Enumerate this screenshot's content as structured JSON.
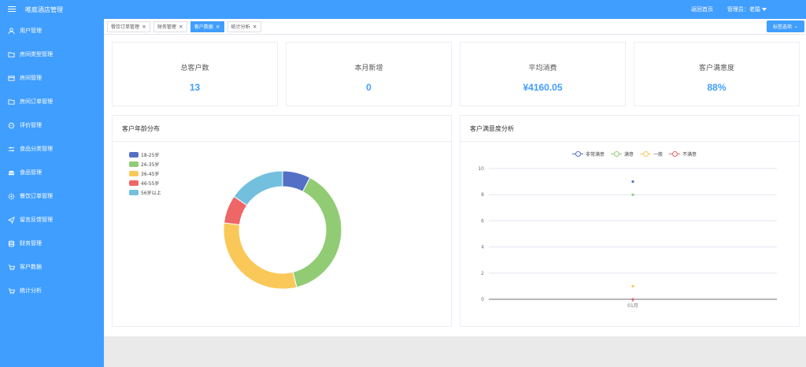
{
  "app": {
    "title": "唯庭酒店管理"
  },
  "sidebar": {
    "items": [
      {
        "label": "用户管理",
        "icon": "user-icon"
      },
      {
        "label": "房间类型管理",
        "icon": "folder-icon"
      },
      {
        "label": "房间管理",
        "icon": "card-icon"
      },
      {
        "label": "房间订单管理",
        "icon": "folder-icon"
      },
      {
        "label": "评价管理",
        "icon": "chat-icon"
      },
      {
        "label": "食品分类管理",
        "icon": "sliders-icon"
      },
      {
        "label": "食品管理",
        "icon": "food-icon"
      },
      {
        "label": "餐饮订单管理",
        "icon": "gear-icon"
      },
      {
        "label": "留言反馈管理",
        "icon": "send-icon"
      },
      {
        "label": "财务管理",
        "icon": "database-icon"
      },
      {
        "label": "客户数据",
        "icon": "cart-icon"
      },
      {
        "label": "统计分析",
        "icon": "cart-icon"
      }
    ]
  },
  "topbar": {
    "home_link": "返回首页",
    "admin_label": "管理员：老猿"
  },
  "tags": [
    {
      "label": "餐饮订单管理",
      "active": false
    },
    {
      "label": "财务管理",
      "active": false
    },
    {
      "label": "客户数据",
      "active": true
    },
    {
      "label": "统计分析",
      "active": false
    }
  ],
  "tag_options": {
    "label": "标签选项"
  },
  "stats": [
    {
      "label": "总客户数",
      "value": "13"
    },
    {
      "label": "本月新增",
      "value": "0"
    },
    {
      "label": "平均消费",
      "value": "¥4160.05"
    },
    {
      "label": "客户满意度",
      "value": "88%"
    }
  ],
  "colors": {
    "accent": "#409eff"
  },
  "chart_data": [
    {
      "type": "pie",
      "title": "客户年龄分布",
      "categories": [
        "18-25岁",
        "26-35岁",
        "36-45岁",
        "46-55岁",
        "56岁以上"
      ],
      "values": [
        1,
        5,
        4,
        1,
        2
      ],
      "colors": [
        "#5470c6",
        "#91cc75",
        "#fac858",
        "#ee6666",
        "#73c0de"
      ],
      "legend_position": "top-left"
    },
    {
      "type": "scatter",
      "title": "客户满意度分析",
      "categories": [
        "01月"
      ],
      "series": [
        {
          "name": "非常满意",
          "values": [
            9
          ],
          "color": "#5470c6"
        },
        {
          "name": "满意",
          "values": [
            8
          ],
          "color": "#91cc75"
        },
        {
          "name": "一般",
          "values": [
            1
          ],
          "color": "#fac858"
        },
        {
          "name": "不满意",
          "values": [
            0
          ],
          "color": "#ee6666"
        }
      ],
      "ylim": [
        0,
        10
      ],
      "yticks": [
        0,
        2,
        4,
        6,
        8,
        10
      ],
      "grid": true,
      "legend_position": "top"
    }
  ]
}
